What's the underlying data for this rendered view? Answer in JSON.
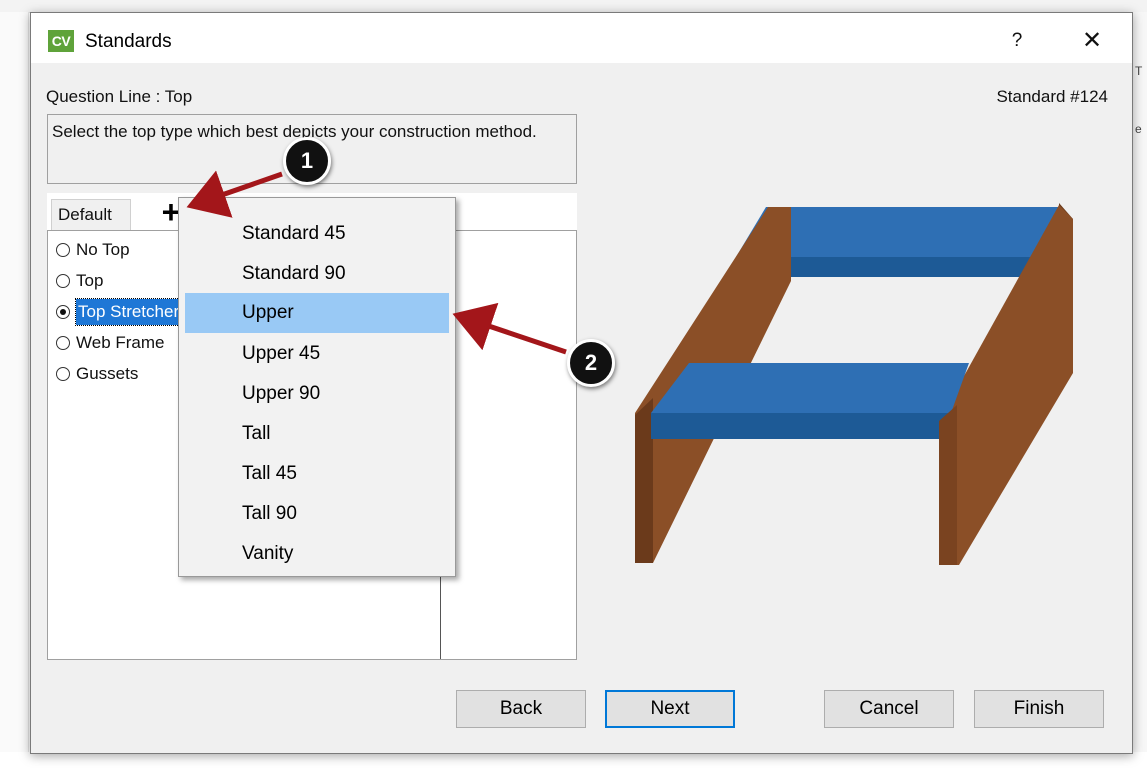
{
  "background": {
    "right_fragments": [
      "T",
      "e"
    ]
  },
  "dialog": {
    "app_logo": "CV",
    "title": "Standards",
    "help": "?",
    "close": "✕",
    "question_line": "Question Line : Top",
    "standard_number": "Standard #124",
    "description": "Select the top type which best depicts your construction method."
  },
  "tabs": {
    "default": "Default",
    "add": "+"
  },
  "options": [
    {
      "label": "No Top",
      "checked": false
    },
    {
      "label": "Top",
      "checked": false
    },
    {
      "label": "Top Stretcher",
      "checked": true
    },
    {
      "label": "Web Frame",
      "checked": false
    },
    {
      "label": "Gussets",
      "checked": false
    }
  ],
  "menu": {
    "items": [
      "Standard 45",
      "Standard 90",
      "Upper",
      "Upper 45",
      "Upper 90",
      "Tall",
      "Tall 45",
      "Tall 90",
      "Vanity"
    ],
    "highlighted": "Upper"
  },
  "buttons": {
    "back": "Back",
    "next": "Next",
    "cancel": "Cancel",
    "finish": "Finish"
  },
  "callouts": [
    "1",
    "2"
  ],
  "colors": {
    "accent": "#0078d7",
    "wood": "#8b4f27",
    "stretcher_blue": "#2e6fb4",
    "annotation_arrow": "#a3161a",
    "menu_highlight": "#99c9f5"
  }
}
